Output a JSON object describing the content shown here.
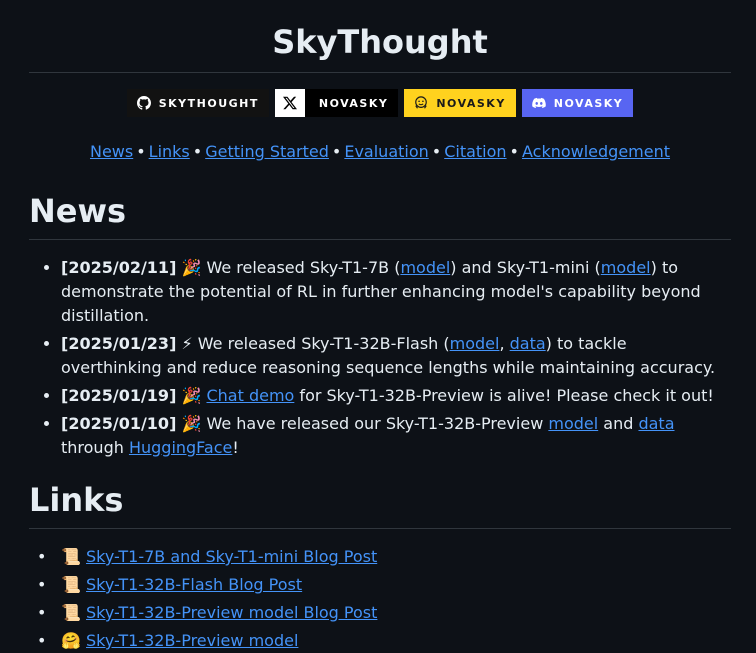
{
  "title": "SkyThought",
  "badges": [
    {
      "label": "SKYTHOUGHT",
      "icon": "github-icon"
    },
    {
      "label": "NOVASKY",
      "icon": "x-icon"
    },
    {
      "label": "NOVASKY",
      "icon": "huggingface-icon"
    },
    {
      "label": "NOVASKY",
      "icon": "discord-icon"
    }
  ],
  "toc": [
    "News",
    "Links",
    "Getting Started",
    "Evaluation",
    "Citation",
    "Acknowledgement"
  ],
  "toc_sep": "•",
  "news_heading": "News",
  "news": [
    {
      "date": "[2025/02/11]",
      "emoji": "🎉",
      "t1": " We released Sky-T1-7B (",
      "l1": "model",
      "t2": ") and Sky-T1-mini (",
      "l2": "model",
      "t3": ") to demonstrate the potential of RL in further enhancing model's capability beyond distillation."
    },
    {
      "date": "[2025/01/23]",
      "emoji": "⚡",
      "t1": " We released Sky-T1-32B-Flash (",
      "l1": "model",
      "t2": ", ",
      "l2": "data",
      "t3": ") to tackle overthinking and reduce reasoning sequence lengths while maintaining accuracy."
    },
    {
      "date": "[2025/01/19]",
      "emoji": "🎉",
      "t1": " ",
      "l1": "Chat demo",
      "t2": " for Sky-T1-32B-Preview is alive! Please check it out!"
    },
    {
      "date": "[2025/01/10]",
      "emoji": "🎉",
      "t1": " We have released our Sky-T1-32B-Preview ",
      "l1": "model",
      "t2": " and ",
      "l2": "data",
      "t3": " through ",
      "l3": "HuggingFace",
      "t4": "!"
    }
  ],
  "links_heading": "Links",
  "links": [
    {
      "emoji": "📜",
      "label": "Sky-T1-7B and Sky-T1-mini Blog Post"
    },
    {
      "emoji": "📜",
      "label": "Sky-T1-32B-Flash Blog Post"
    },
    {
      "emoji": "📜",
      "label": "Sky-T1-32B-Preview model Blog Post"
    },
    {
      "emoji": "🤗",
      "label": "Sky-T1-32B-Preview model"
    }
  ],
  "colors": {
    "background": "#0d1117",
    "link": "#4493f8",
    "huggingface": "#ffd21e",
    "discord": "#5865f2"
  }
}
